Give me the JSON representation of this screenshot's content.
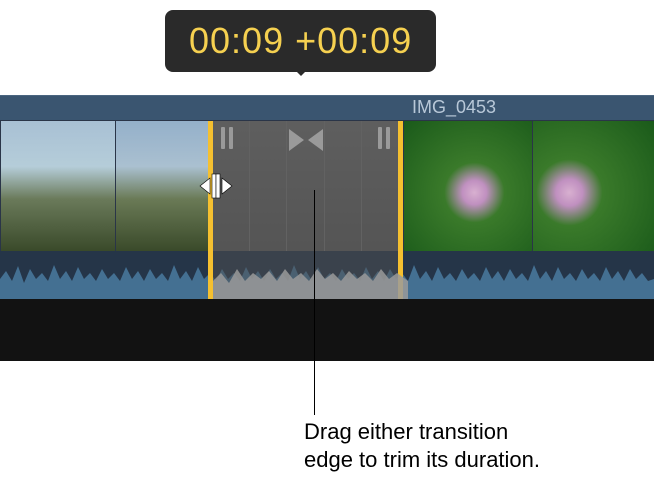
{
  "tooltip": {
    "time": "00:09",
    "delta": "+00:09"
  },
  "clip": {
    "name": "IMG_0453"
  },
  "callout": {
    "line1": "Drag either transition",
    "line2": "edge to trim its duration."
  },
  "icons": {
    "transition_center": "bowtie-icon",
    "trim_handle_left": "handle-icon",
    "trim_handle_right": "handle-icon",
    "trim_cursor": "trim-edge-cursor"
  },
  "colors": {
    "selection": "#f5c030",
    "tooltip_text": "#f5d050",
    "tooltip_bg": "#2a2a2a",
    "clip_header": "#3a5570",
    "waveform": "#4a7aa0"
  }
}
